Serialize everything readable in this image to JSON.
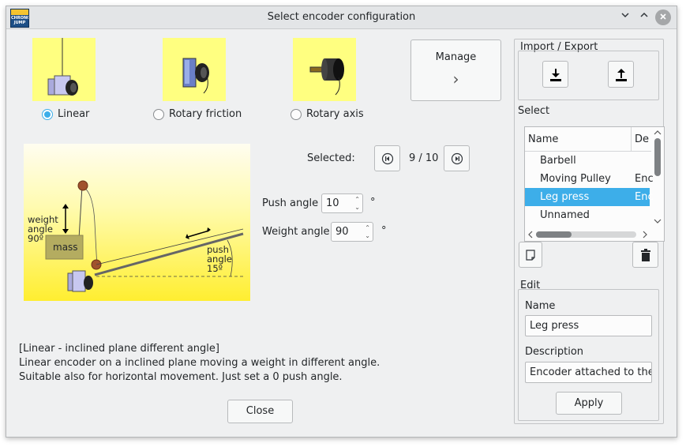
{
  "window": {
    "title": "Select encoder configuration",
    "app_logo_text": "CHRONO JUMP"
  },
  "encoder_types": [
    {
      "label": "Linear",
      "selected": true
    },
    {
      "label": "Rotary friction",
      "selected": false
    },
    {
      "label": "Rotary axis",
      "selected": false
    }
  ],
  "manage": {
    "label": "Manage",
    "arrow": "›"
  },
  "diagram": {
    "weight_angle_label": [
      "weight",
      "angle",
      "90º"
    ],
    "mass_label": "mass",
    "push_angle_label": [
      "push",
      "angle",
      "15º"
    ]
  },
  "selected": {
    "label": "Selected:",
    "value": "9 / 10"
  },
  "push_angle": {
    "label": "Push angle",
    "value": "10",
    "unit": "°"
  },
  "weight_angle": {
    "label": "Weight angle",
    "value": "90",
    "unit": "°"
  },
  "description_text": {
    "line1": "[Linear - inclined plane different angle]",
    "line2": "Linear encoder on a inclined plane moving a weight in different angle.",
    "line3": "Suitable also for horizontal movement. Just set a 0 push angle."
  },
  "close_label": "Close",
  "import_export": {
    "title": "Import  /  Export"
  },
  "select_list": {
    "title": "Select",
    "columns": [
      "Name",
      "De"
    ],
    "rows": [
      {
        "name": "Barbell",
        "desc": "",
        "selected": false
      },
      {
        "name": "Moving Pulley",
        "desc": "Enc",
        "selected": false
      },
      {
        "name": "Leg press",
        "desc": "Enc",
        "selected": true
      },
      {
        "name": "Unnamed",
        "desc": "",
        "selected": false
      }
    ]
  },
  "edit": {
    "title": "Edit",
    "name_label": "Name",
    "name_value": "Leg press",
    "description_label": "Description",
    "description_value": "Encoder attached to the le",
    "apply_label": "Apply"
  },
  "colors": {
    "accent": "#3daee9",
    "thumb_bg": "#ffff80"
  }
}
